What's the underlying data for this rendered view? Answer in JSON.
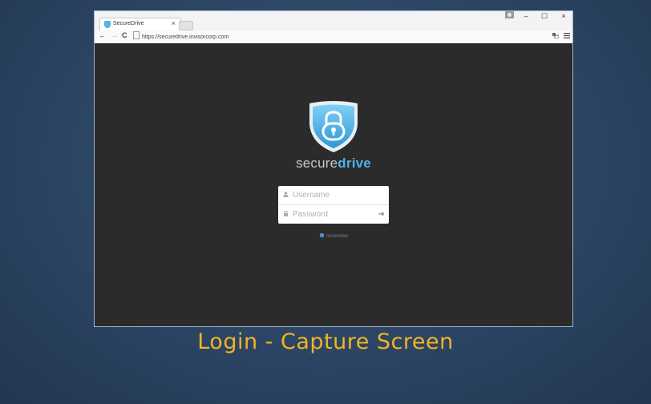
{
  "browser": {
    "tab_title": "SecureDrive",
    "tab_close": "×",
    "url": "https://securedrive.invisorcorp.com",
    "window_min": "–",
    "window_max": "☐",
    "window_close": "×",
    "nav_back": "←",
    "nav_forward": "→",
    "nav_reload": "C"
  },
  "login": {
    "brand_light": "secure",
    "brand_bold": "drive",
    "username_placeholder": "Username",
    "password_placeholder": "Password",
    "submit_symbol": "➜",
    "remember_label": "remember"
  },
  "caption": "Login - Capture Screen",
  "colors": {
    "accent": "#4fb3e8",
    "caption": "#f2b422",
    "viewport": "#2b2b2b"
  }
}
